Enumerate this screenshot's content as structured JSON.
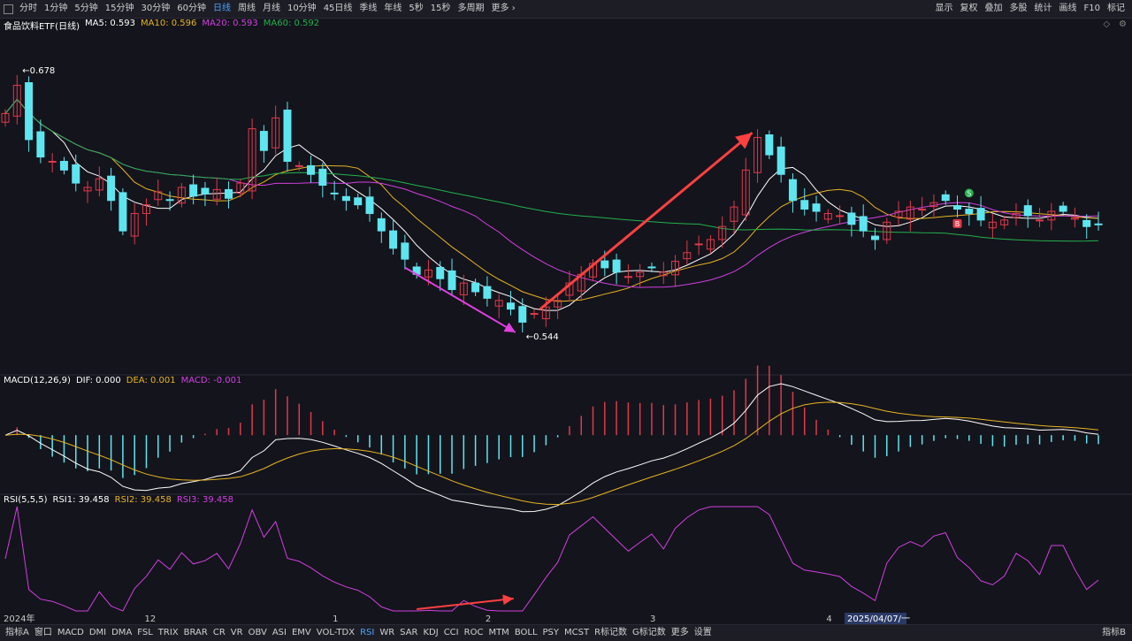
{
  "topbar": {
    "left_items": [
      "分时",
      "1分钟",
      "5分钟",
      "15分钟",
      "30分钟",
      "60分钟",
      "日线",
      "周线",
      "月线",
      "10分钟",
      "45日线",
      "季线",
      "年线",
      "5秒",
      "15秒",
      "多周期",
      "更多 ›"
    ],
    "active_index": 6,
    "right_items": [
      "显示",
      "复权",
      "叠加",
      "多股",
      "统计",
      "画线",
      "F10",
      "标记"
    ]
  },
  "main_legend": {
    "title": "食品饮料ETF(日线)",
    "ma": [
      {
        "label": "MA5: 0.593",
        "color": "#ffffff"
      },
      {
        "label": "MA10: 0.596",
        "color": "#e6b422"
      },
      {
        "label": "MA20: 0.593",
        "color": "#d040e0"
      },
      {
        "label": "MA60: 0.592",
        "color": "#22b14c"
      }
    ]
  },
  "macd_legend": {
    "title": "MACD(12,26,9)",
    "items": [
      {
        "label": "DIF: 0.000",
        "color": "#ffffff"
      },
      {
        "label": "DEA: 0.001",
        "color": "#e6b422"
      },
      {
        "label": "MACD: -0.001",
        "color": "#d040e0"
      }
    ]
  },
  "rsi_legend": {
    "title": "RSI(5,5,5)",
    "items": [
      {
        "label": "RSI1: 39.458",
        "color": "#ffffff"
      },
      {
        "label": "RSI2: 39.458",
        "color": "#e6b422"
      },
      {
        "label": "RSI3: 39.458",
        "color": "#d040e0"
      }
    ]
  },
  "annotations": {
    "high_label": "0.678",
    "low_label": "0.544",
    "date_label": "2025/04/07/一"
  },
  "signals": {
    "s": "S",
    "b": "B"
  },
  "x_ticks": [
    "2024年",
    "12",
    "1",
    "2",
    "3",
    "4"
  ],
  "bottombar": {
    "items": [
      "指标A",
      "窗口",
      "MACD",
      "DMI",
      "DMA",
      "FSL",
      "TRIX",
      "BRAR",
      "CR",
      "VR",
      "OBV",
      "ASI",
      "EMV",
      "VOL-TDX",
      "RSI",
      "WR",
      "SAR",
      "KDJ",
      "CCI",
      "ROC",
      "MTM",
      "BOLL",
      "PSY",
      "MCST",
      "R标记数",
      "G标记数",
      "更多",
      "设置"
    ],
    "active_index": 14,
    "right_label": "指标B"
  },
  "colors": {
    "up": "#e0394a",
    "down": "#5ee6f0",
    "ma5": "#ffffff",
    "ma10": "#e6b422",
    "ma20": "#d040e0",
    "ma60": "#22b14c",
    "arrow_red": "#ff4040",
    "arrow_pink": "#e040e0"
  },
  "chart_data": {
    "type": "candlestick",
    "panels": [
      "price",
      "macd",
      "rsi"
    ],
    "price_range": [
      0.535,
      0.69
    ],
    "ohlc_closes": [
      0.652,
      0.665,
      0.64,
      0.632,
      0.63,
      0.626,
      0.62,
      0.618,
      0.622,
      0.612,
      0.598,
      0.606,
      0.61,
      0.616,
      0.612,
      0.618,
      0.614,
      0.615,
      0.617,
      0.613,
      0.62,
      0.645,
      0.635,
      0.65,
      0.63,
      0.628,
      0.624,
      0.619,
      0.615,
      0.612,
      0.61,
      0.606,
      0.598,
      0.59,
      0.585,
      0.578,
      0.58,
      0.576,
      0.571,
      0.574,
      0.57,
      0.567,
      0.566,
      0.562,
      0.556,
      0.56,
      0.563,
      0.566,
      0.574,
      0.578,
      0.583,
      0.581,
      0.579,
      0.577,
      0.579,
      0.581,
      0.579,
      0.584,
      0.588,
      0.592,
      0.594,
      0.6,
      0.609,
      0.626,
      0.641,
      0.633,
      0.624,
      0.612,
      0.608,
      0.607,
      0.606,
      0.605,
      0.601,
      0.598,
      0.594,
      0.602,
      0.607,
      0.609,
      0.608,
      0.611,
      0.612,
      0.608,
      0.606,
      0.603,
      0.602,
      0.603,
      0.606,
      0.605,
      0.603,
      0.607,
      0.607,
      0.604,
      0.6,
      0.601
    ],
    "macd_range": [
      -0.012,
      0.01
    ],
    "rsi_range": [
      15,
      85
    ]
  }
}
